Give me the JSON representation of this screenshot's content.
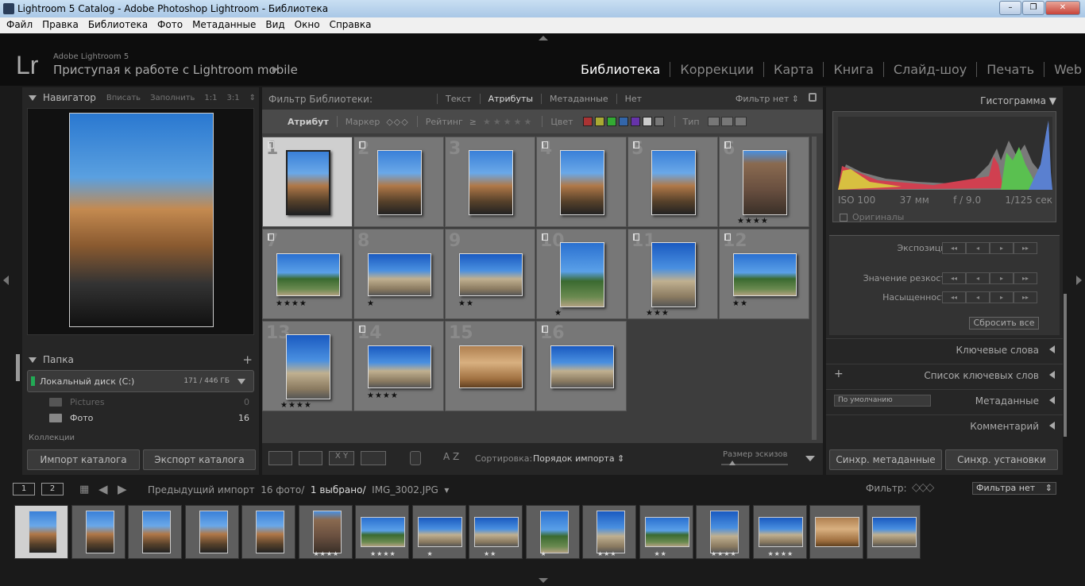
{
  "window": {
    "title": "Lightroom 5 Catalog - Adobe Photoshop Lightroom - Библиотека",
    "buttons": [
      "–",
      "❐",
      "✕"
    ]
  },
  "menu": [
    "Файл",
    "Правка",
    "Библиотека",
    "Фото",
    "Метаданные",
    "Вид",
    "Окно",
    "Справка"
  ],
  "identity": {
    "logo": "Lr",
    "product": "Adobe Lightroom 5",
    "tagline": "Приступая к работе с Lightroom mobile",
    "arrow": "▶"
  },
  "modules": [
    "Библиотека",
    "Коррекции",
    "Карта",
    "Книга",
    "Слайд-шоу",
    "Печать",
    "Web"
  ],
  "left": {
    "navigator": {
      "title": "Навигатор",
      "zoom": [
        "Вписать",
        "Заполнить",
        "1:1",
        "3:1"
      ],
      "zoom_arrow": "⇕"
    },
    "folders": {
      "title": "Папка",
      "plus": "+",
      "drive": "Локальный диск (C:)",
      "drive_size": "171 / 446 ГБ",
      "items": [
        {
          "name": "Pictures",
          "count": "0"
        },
        {
          "name": "Фото",
          "count": "16"
        }
      ]
    },
    "collections_title": "Коллекции",
    "import_btn": "Импорт каталога",
    "export_btn": "Экспорт каталога"
  },
  "filter": {
    "label": "Фильтр Библиотеки:",
    "options": [
      "Текст",
      "Атрибуты",
      "Метаданные",
      "Нет"
    ],
    "selected": "Атрибуты",
    "preset": "Фильтр нет ⇕",
    "attribute_label": "Атрибут",
    "marker_label": "Маркер",
    "marker_icons": "◇◇◇",
    "rating_label": "Рейтинг",
    "rating_op": "≥",
    "rating_stars": "★★★★★",
    "color_label": "Цвет",
    "colors": [
      "#a33",
      "#aa3",
      "#3a3",
      "#36a",
      "#63a",
      "#ccc",
      "#777"
    ],
    "type_label": "Тип"
  },
  "grid": [
    {
      "num": "1",
      "flag": true,
      "stars": "",
      "selected": true,
      "orient": "portrait",
      "tone": "street"
    },
    {
      "num": "2",
      "flag": true,
      "stars": "",
      "selected": false,
      "orient": "portrait",
      "tone": "street"
    },
    {
      "num": "3",
      "flag": false,
      "stars": "",
      "selected": false,
      "orient": "portrait",
      "tone": "street"
    },
    {
      "num": "4",
      "flag": true,
      "stars": "",
      "selected": false,
      "orient": "portrait",
      "tone": "street"
    },
    {
      "num": "5",
      "flag": true,
      "stars": "",
      "selected": false,
      "orient": "portrait",
      "tone": "street"
    },
    {
      "num": "6",
      "flag": true,
      "stars": "★★★★",
      "selected": false,
      "orient": "portrait",
      "tone": "wall"
    },
    {
      "num": "7",
      "flag": true,
      "stars": "★★★★",
      "selected": false,
      "orient": "landscape",
      "tone": "trees"
    },
    {
      "num": "8",
      "flag": false,
      "stars": "★",
      "selected": false,
      "orient": "landscape",
      "tone": "ruin"
    },
    {
      "num": "9",
      "flag": false,
      "stars": "★★",
      "selected": false,
      "orient": "landscape",
      "tone": "ruin"
    },
    {
      "num": "10",
      "flag": true,
      "stars": "★",
      "selected": false,
      "orient": "portrait",
      "tone": "trees"
    },
    {
      "num": "11",
      "flag": true,
      "stars": "★★★",
      "selected": false,
      "orient": "portrait",
      "tone": "ruin"
    },
    {
      "num": "12",
      "flag": true,
      "stars": "★★",
      "selected": false,
      "orient": "landscape",
      "tone": "trees"
    },
    {
      "num": "13",
      "flag": false,
      "stars": "★★★★",
      "selected": false,
      "orient": "portrait",
      "tone": "ruin"
    },
    {
      "num": "14",
      "flag": true,
      "stars": "★★★★",
      "selected": false,
      "orient": "landscape",
      "tone": "ruin"
    },
    {
      "num": "15",
      "flag": false,
      "stars": "",
      "selected": false,
      "orient": "landscape",
      "tone": "stone"
    },
    {
      "num": "16",
      "flag": true,
      "stars": "",
      "selected": false,
      "orient": "landscape",
      "tone": "ruin"
    }
  ],
  "toolbar": {
    "sort_label": "Сортировка:",
    "sort_value": "Порядок импорта",
    "sort_arrow": "⇕",
    "thumb_label": "Размер эскизов",
    "view_xy": "X Y",
    "az": "A Z"
  },
  "right": {
    "histogram_title": "Гистограмма",
    "exif": [
      "ISO 100",
      "37 мм",
      "f / 9.0",
      "1/125 сек"
    ],
    "originals": "Оригиналы",
    "quick": [
      {
        "label": "Экспозиция"
      },
      {
        "label": "Значение резкости"
      },
      {
        "label": "Насыщенность"
      }
    ],
    "quick_buttons": [
      "◂◂",
      "◂",
      "▸",
      "▸▸"
    ],
    "reset": "Сбросить все",
    "sections": [
      "Ключевые слова",
      "Список ключевых слов",
      "Метаданные",
      "Комментарий"
    ],
    "kw_plus": "+",
    "meta_preset": "По умолчанию",
    "sync_meta": "Синхр. метаданные",
    "sync_settings": "Синхр. установки"
  },
  "filmbar": {
    "screen1": "1",
    "screen2": "2",
    "source": "Предыдущий импорт",
    "count": "16 фото/",
    "selected": "1 выбрано/",
    "file": "IMG_3002.JPG",
    "file_arrow": "▾",
    "filter_label": "Фильтр:",
    "filter_value": "Фильтра нет",
    "filter_arrow": "⇕"
  },
  "tones": {
    "street": "linear-gradient(180deg,#3a80d8 0%,#6aa8e8 35%,#b07848 55%,#55402a 80%,#222 100%)",
    "wall": "linear-gradient(180deg,#4a90e0 0%,#8a6a50 20%,#6a5040 60%,#3a3028 100%)",
    "trees": "linear-gradient(180deg,#2a70d0 0%,#5aa0e8 45%,#3a6a30 60%,#6a8a50 85%,#b0a080 100%)",
    "ruin": "linear-gradient(180deg,#1a5ac0 0%,#4a90e0 40%,#c0b090 60%,#8a7a60 85%,#555 100%)",
    "stone": "linear-gradient(180deg,#b08050 0%,#d8b080 40%,#a07040 80%,#604020 100%)"
  }
}
